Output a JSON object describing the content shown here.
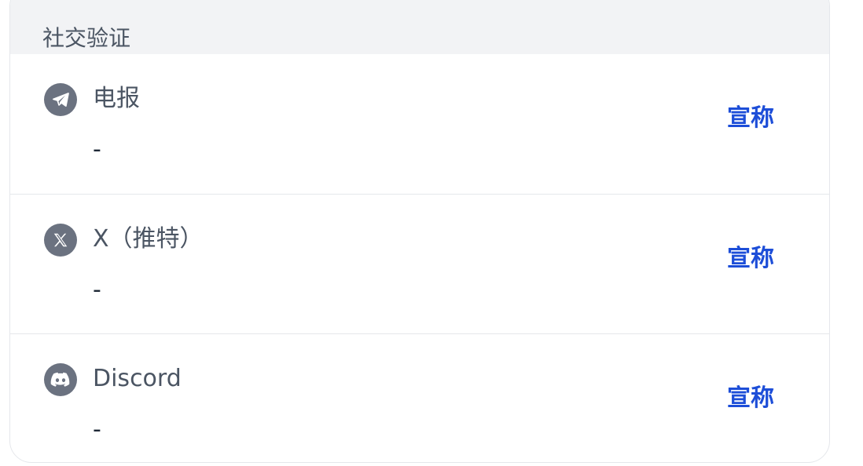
{
  "section": {
    "title": "社交验证"
  },
  "rows": [
    {
      "icon": "telegram-icon",
      "name": "电报",
      "value": "-",
      "action_label": "宣称"
    },
    {
      "icon": "x-twitter-icon",
      "name": "X（推特）",
      "value": "-",
      "action_label": "宣称"
    },
    {
      "icon": "discord-icon",
      "name": "Discord",
      "value": "-",
      "action_label": "宣称"
    }
  ],
  "colors": {
    "header_bg": "#f2f3f5",
    "icon_bg": "#6b7280",
    "accent": "#1d4ed8",
    "border": "#e5e7eb"
  }
}
